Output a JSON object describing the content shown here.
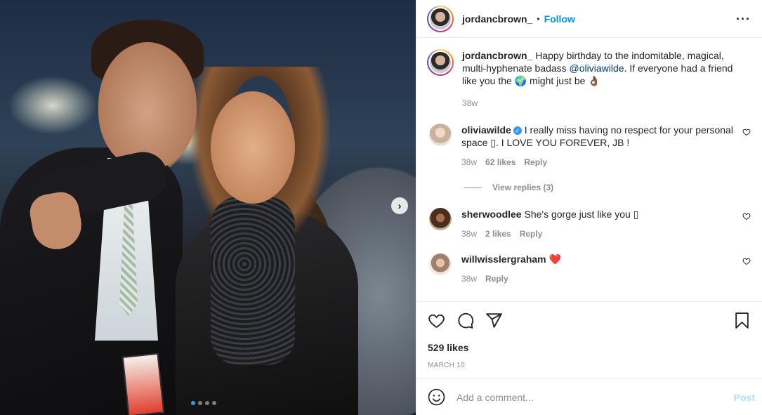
{
  "post": {
    "author": "jordancbrown_",
    "follow_label": "Follow",
    "separator": "•",
    "more_icon": "more-horizontal-icon",
    "image_alt": "photo",
    "next_icon": "›",
    "carousel_count": 4,
    "carousel_active": 1
  },
  "caption": {
    "username": "jordancbrown_",
    "text_before": " Happy birthday to the indomitable, magical, multi-hyphenate badass ",
    "mention": "@oliviawilde",
    "text_after": ". If everyone had a friend like you the 🌍 might just be 👌🏾",
    "time": "38w"
  },
  "comments": [
    {
      "username": "oliviawilde",
      "verified": true,
      "text": "I really miss having no respect for your personal space ▯. I LOVE YOU FOREVER, JB !",
      "time": "38w",
      "likes": "62 likes",
      "reply": "Reply",
      "view_replies": "View replies (3)"
    },
    {
      "username": "sherwoodlee",
      "text": "She's gorge just like you ▯",
      "time": "38w",
      "likes": "2 likes",
      "reply": "Reply"
    },
    {
      "username": "willwisslergraham",
      "text": "❤️",
      "time": "38w",
      "reply": "Reply"
    }
  ],
  "actions": {
    "likes": "529 likes",
    "date": "MARCH 10"
  },
  "add_comment": {
    "placeholder": "Add a comment...",
    "post_label": "Post"
  },
  "colors": {
    "accent": "#0095f6",
    "heart_red": "#ed4956",
    "muted": "#8e8e8e"
  }
}
